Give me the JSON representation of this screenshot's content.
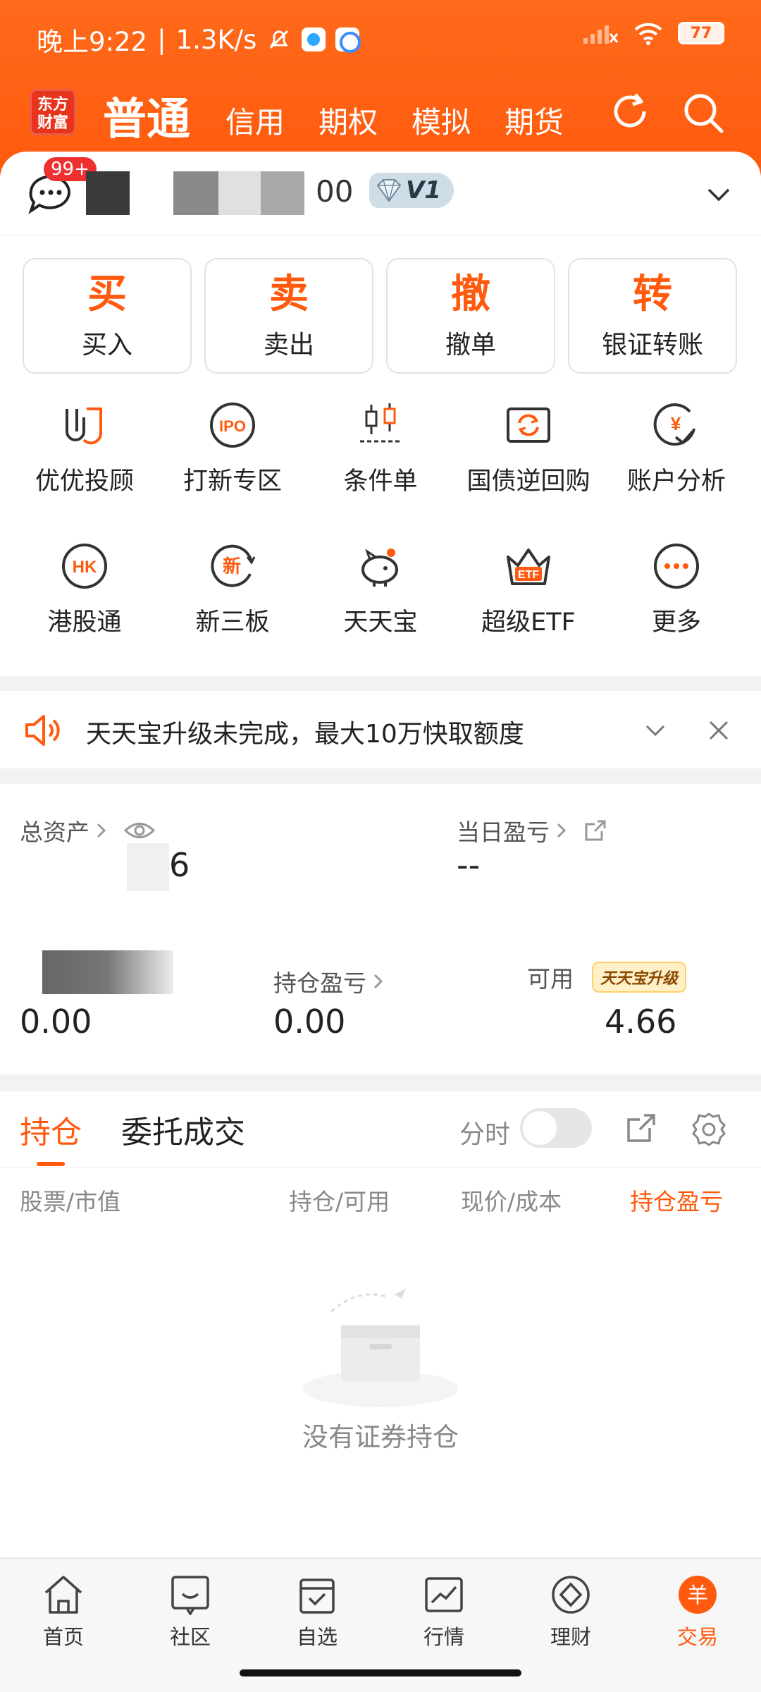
{
  "status_bar": {
    "time": "晚上9:22",
    "speed": "1.3K/s",
    "battery": "77"
  },
  "header": {
    "logo": "东方财富",
    "tabs": [
      "普通",
      "信用",
      "期权",
      "模拟",
      "期货"
    ]
  },
  "account": {
    "message_badge": "99+",
    "account_suffix": "00",
    "vip_level": "V1"
  },
  "trade_actions": [
    {
      "icon_char": "买",
      "label": "买入"
    },
    {
      "icon_char": "卖",
      "label": "卖出"
    },
    {
      "icon_char": "撤",
      "label": "撤单"
    },
    {
      "icon_char": "转",
      "label": "银证转账"
    }
  ],
  "services": [
    {
      "label": "优优投顾",
      "icon": "uu-advisor-icon"
    },
    {
      "label": "打新专区",
      "icon": "ipo-icon"
    },
    {
      "label": "条件单",
      "icon": "candlestick-icon"
    },
    {
      "label": "国债逆回购",
      "icon": "repo-icon"
    },
    {
      "label": "账户分析",
      "icon": "yen-analysis-icon"
    },
    {
      "label": "港股通",
      "icon": "hk-icon"
    },
    {
      "label": "新三板",
      "icon": "new-board-icon"
    },
    {
      "label": "天天宝",
      "icon": "piggy-bank-icon"
    },
    {
      "label": "超级ETF",
      "icon": "etf-crown-icon"
    },
    {
      "label": "更多",
      "icon": "more-icon"
    }
  ],
  "notice": {
    "text": "天天宝升级未完成，最大10万快取额度"
  },
  "assets": {
    "total_label": "总资产",
    "total_value": "6",
    "daily_pl_label": "当日盈亏",
    "daily_pl_value": "--",
    "left_value": "0.00",
    "position_pl_label": "持仓盈亏",
    "position_pl_value": "0.00",
    "available_label": "可用",
    "upgrade_tag": "天天宝升级",
    "available_value": "4.66"
  },
  "holdings": {
    "tab_positions": "持仓",
    "tab_orders": "委托成交",
    "fenshi_label": "分时",
    "columns": [
      "股票/市值",
      "持仓/可用",
      "现价/成本",
      "持仓盈亏"
    ],
    "empty_text": "没有证券持仓"
  },
  "bottom_nav": [
    "首页",
    "社区",
    "自选",
    "行情",
    "理财",
    "交易"
  ],
  "colors": {
    "accent": "#ff5a0e",
    "header": "#ff6a1a"
  }
}
